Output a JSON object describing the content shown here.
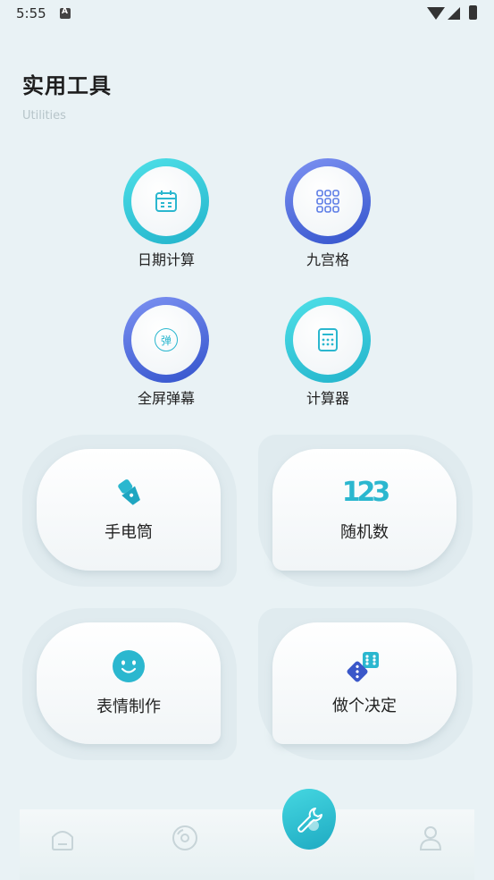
{
  "status_bar": {
    "time": "5:55"
  },
  "header": {
    "title": "实用工具",
    "subtitle": "Utilities"
  },
  "circle_tools": [
    {
      "label": "日期计算",
      "icon": "calendar-icon"
    },
    {
      "label": "九宫格",
      "icon": "grid-icon"
    },
    {
      "label": "全屏弹幕",
      "icon": "danmaku-icon",
      "icon_text": "弹"
    },
    {
      "label": "计算器",
      "icon": "calculator-icon"
    }
  ],
  "cards": [
    {
      "label": "手电筒",
      "icon": "flashlight-icon"
    },
    {
      "label": "随机数",
      "icon": "numbers-icon",
      "icon_text": "123"
    },
    {
      "label": "表情制作",
      "icon": "smiley-icon"
    },
    {
      "label": "做个决定",
      "icon": "dice-icon"
    }
  ],
  "nav": {
    "items": [
      "home-icon",
      "disc-icon",
      "tools-icon",
      "profile-icon"
    ],
    "active": "tools-icon"
  },
  "colors": {
    "cyan": "#22b3cb",
    "blue": "#3353cc",
    "background": "#e9f2f5"
  }
}
